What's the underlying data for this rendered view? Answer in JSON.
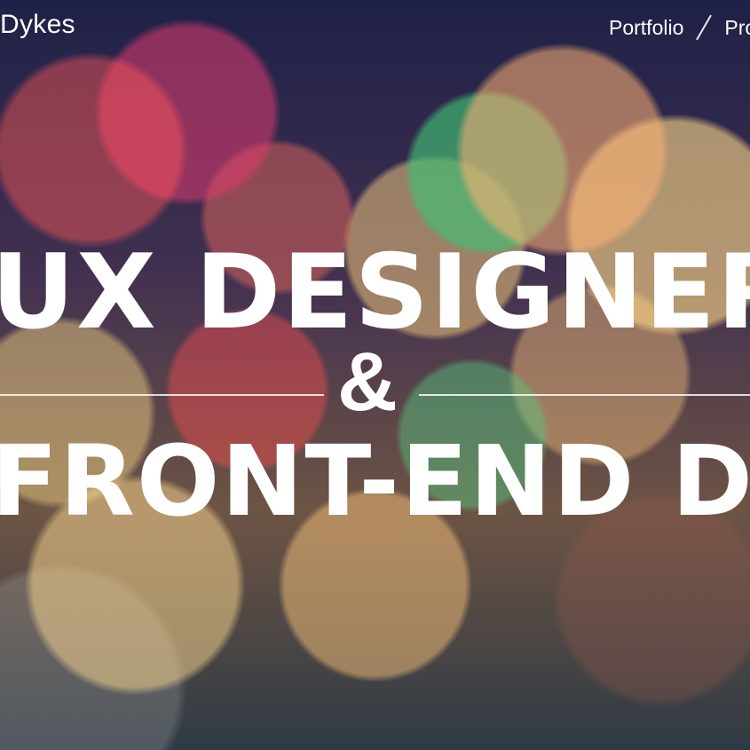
{
  "brand": {
    "name": "Dykes"
  },
  "nav": {
    "items": [
      {
        "label": "Portfolio"
      },
      {
        "label": "Pro"
      }
    ]
  },
  "headline": {
    "line_1": "UX DESIGNER",
    "connector": "&",
    "line_2": "FRONT-END DEV"
  }
}
